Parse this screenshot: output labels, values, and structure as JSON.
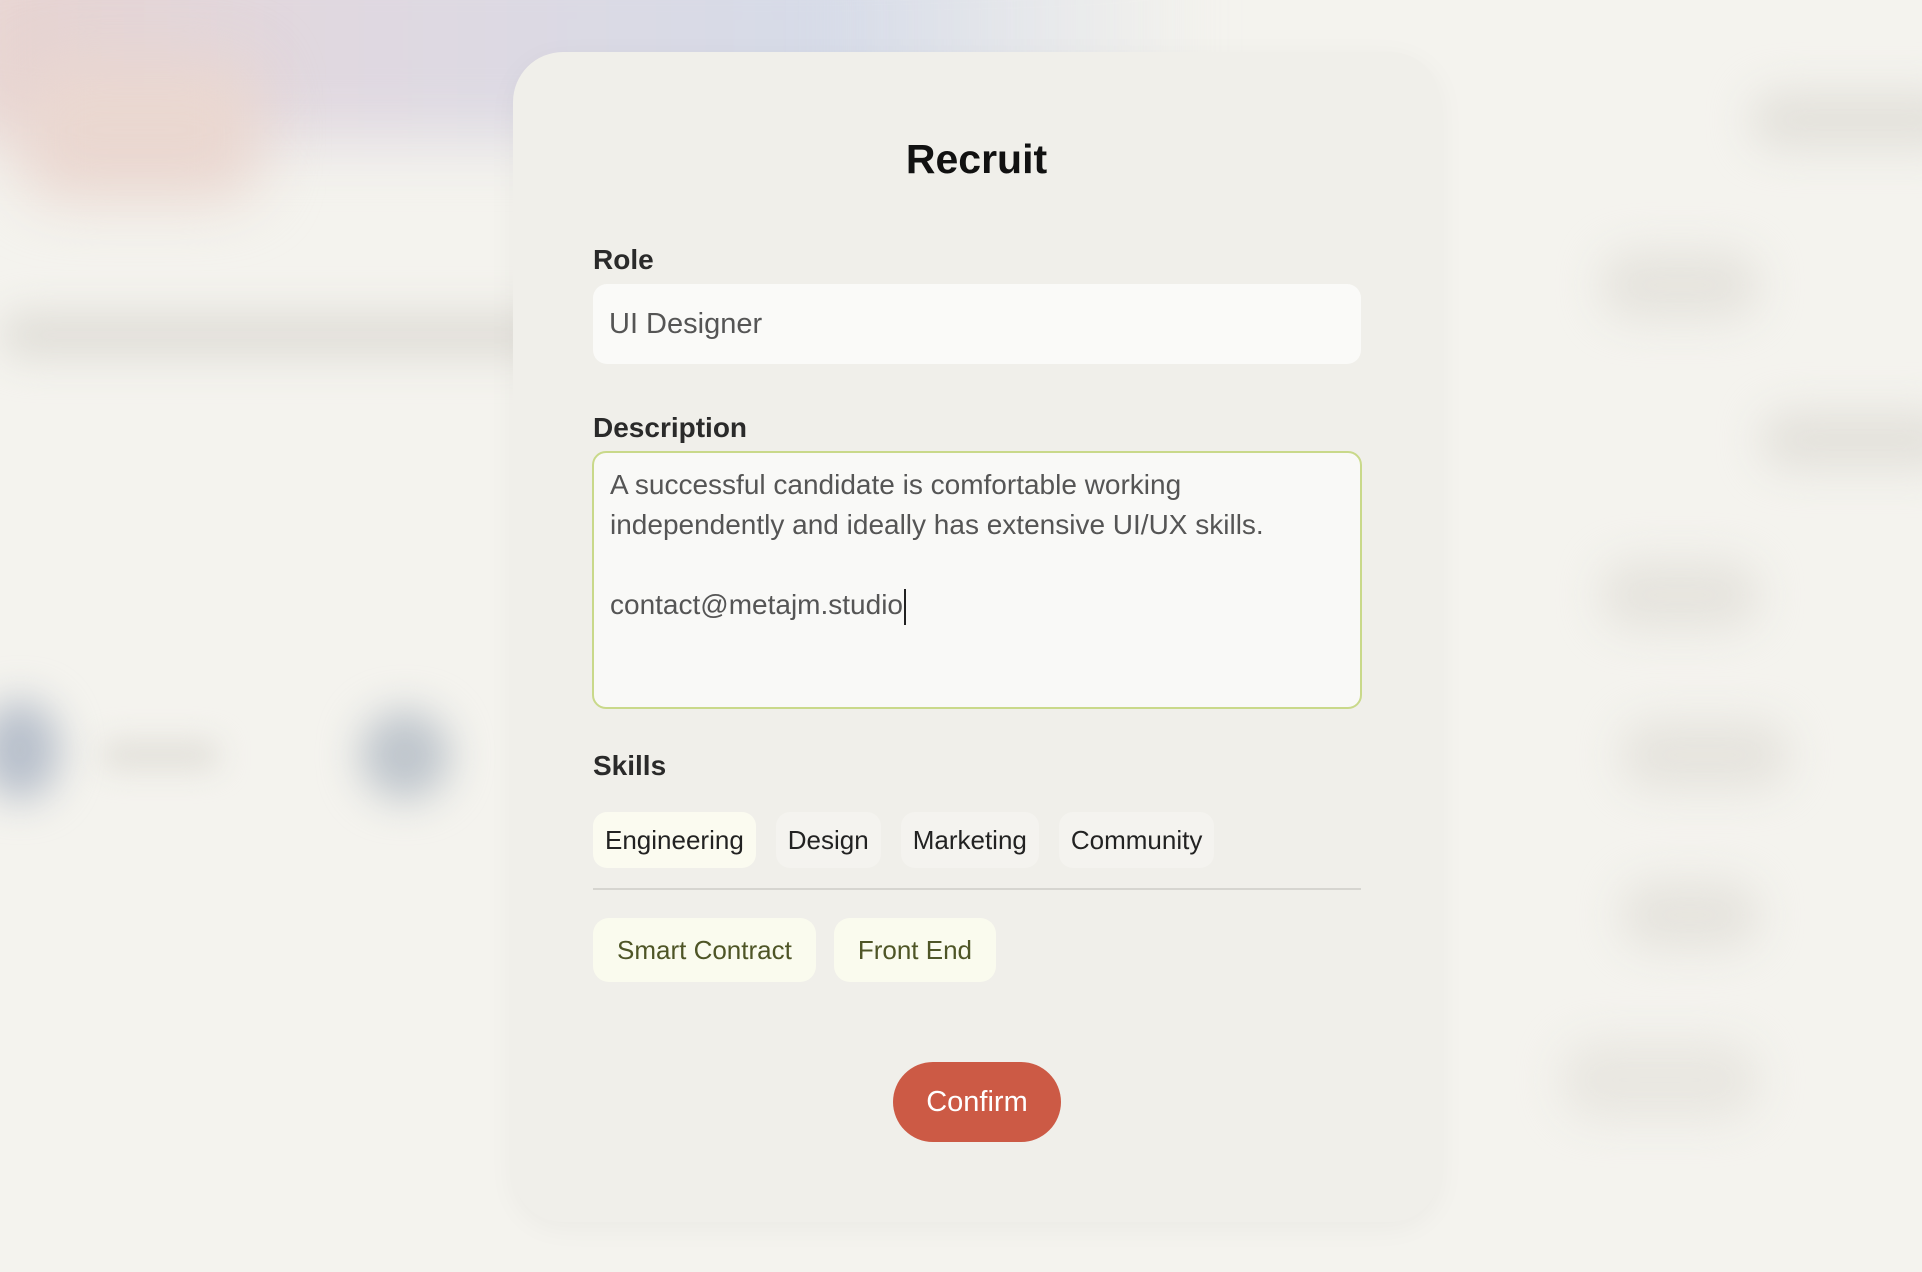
{
  "dialog": {
    "title": "Recruit",
    "role": {
      "label": "Role",
      "value": "UI Designer"
    },
    "description": {
      "label": "Description",
      "line1": "A successful candidate is comfortable working",
      "line2": "independently and ideally has extensive UI/UX skills.",
      "line3": "contact@metajm.studio"
    },
    "skills": {
      "label": "Skills",
      "categories": [
        "Engineering",
        "Design",
        "Marketing",
        "Community"
      ],
      "selected_category": "Engineering",
      "selected_tags": [
        "Smart Contract",
        "Front End"
      ]
    },
    "confirm_label": "Confirm"
  },
  "colors": {
    "accent": "#cc5a45",
    "focus_border": "#c9d98a",
    "tag_text": "#4e5526"
  }
}
